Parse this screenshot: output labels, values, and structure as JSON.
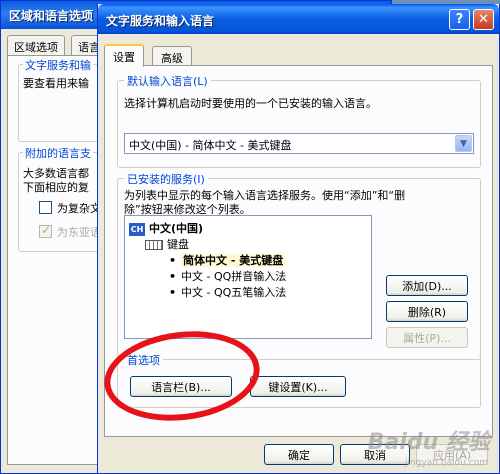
{
  "back_window": {
    "title": "区域和语言选项",
    "tabs": [
      "区域选项",
      "语言"
    ],
    "group1": {
      "legend": "文字服务和输",
      "text": "要查看用来输"
    },
    "group2": {
      "legend": "附加的语言支",
      "text1": "大多数语言都",
      "text2": "下面相应的复",
      "check1": "为复杂文",
      "check2": "为东亚语"
    }
  },
  "dialog": {
    "title": "文字服务和输入语言",
    "help_icon": "?",
    "close_icon": "✕",
    "tabs": [
      "设置",
      "高级"
    ],
    "default_lang": {
      "legend": "默认输入语言(L)",
      "desc": "选择计算机启动时要使用的一个已安装的输入语言。",
      "selected": "中文(中国) - 简体中文 - 美式键盘"
    },
    "installed": {
      "legend": "已安装的服务(I)",
      "desc1": "为列表中显示的每个输入语言选择服务。使用“添加”和“删",
      "desc2": "除”按钮来修改这个列表。",
      "badge": "CH",
      "lang": "中文(中国)",
      "keyboard": "键盘",
      "items": [
        "简体中文 - 美式键盘",
        "中文 - QQ拼音输入法",
        "中文 - QQ五笔输入法"
      ],
      "add_label": "添加(D)...",
      "remove_label": "删除(R)",
      "props_label": "属性(P)..."
    },
    "prefs": {
      "legend": "首选项",
      "langbar_label": "语言栏(B)...",
      "keyset_label": "键设置(K)..."
    },
    "ok_label": "确定",
    "cancel_label": "取消",
    "apply_label": "应用(A)"
  },
  "watermark": {
    "brand": "Baidu 经验",
    "url": "jingyan.baidu.com"
  },
  "annotation_color": "#e8121b"
}
